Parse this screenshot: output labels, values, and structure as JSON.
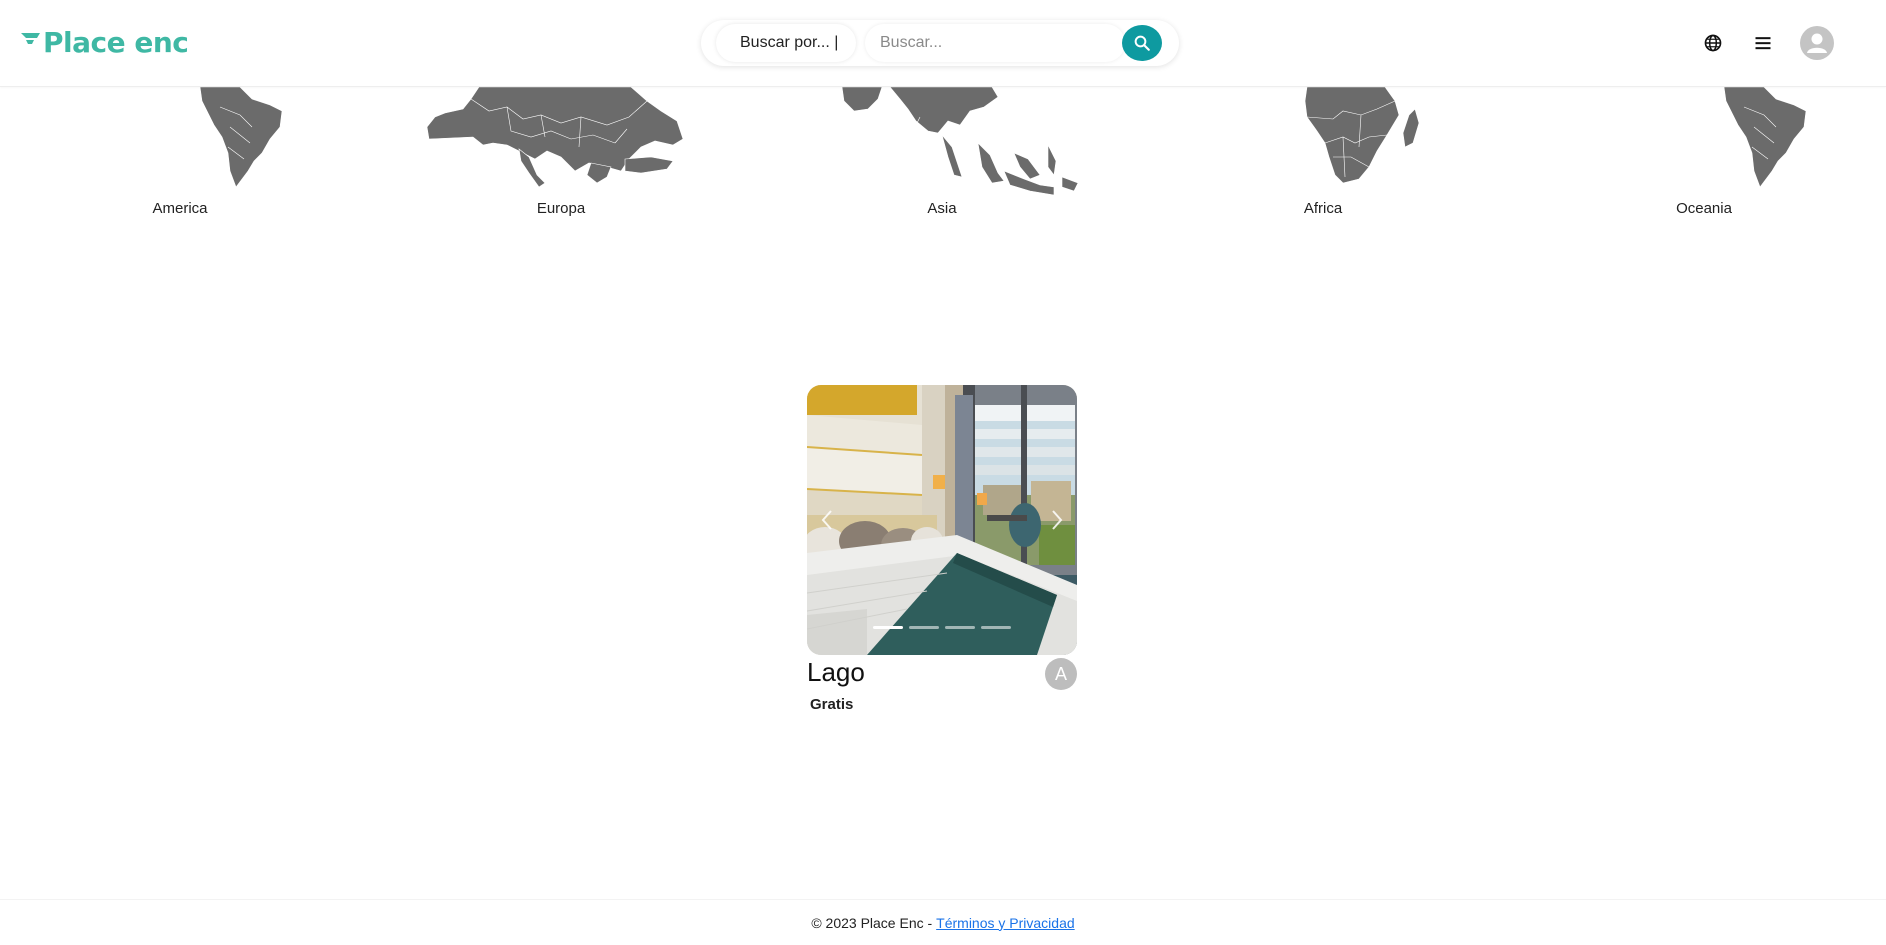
{
  "header": {
    "logo_text": "Place enc",
    "search_type_label": "Buscar por... |",
    "search_placeholder": "Buscar...",
    "search_icon": "search-icon",
    "globe_icon": "globe-icon",
    "menu_icon": "menu-icon",
    "avatar_icon": "user-icon",
    "brand_color": "#3fb8a4",
    "accent_color": "#0e9aa0"
  },
  "continents": [
    {
      "label": "America"
    },
    {
      "label": "Europa"
    },
    {
      "label": "Asia"
    },
    {
      "label": "Africa"
    },
    {
      "label": "Oceania"
    }
  ],
  "card": {
    "title": "Lago",
    "price": "Gratis",
    "badge": "A",
    "slide_count": 4,
    "active_slide": 1
  },
  "footer": {
    "copyright": "© 2023 Place Enc -",
    "link_label": "Términos y Privacidad"
  }
}
